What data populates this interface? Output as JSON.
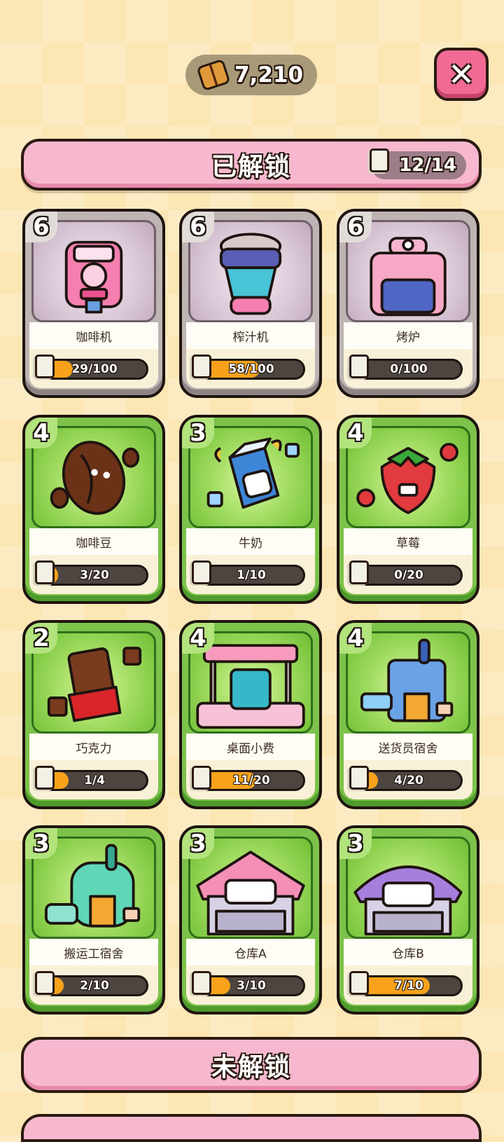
{
  "currency": {
    "amount": "7,210",
    "icon": "coffee-bean-coin-icon"
  },
  "close": {
    "label": "✕"
  },
  "unlocked": {
    "title": "已解锁",
    "count": "12/14"
  },
  "locked": {
    "title": "未解锁"
  },
  "cards": [
    {
      "name": "咖啡机",
      "level": "6",
      "progress": "29/100",
      "fill": 0.29,
      "style": "gray",
      "icon": "coffee-machine-icon"
    },
    {
      "name": "榨汁机",
      "level": "6",
      "progress": "58/100",
      "fill": 0.58,
      "style": "gray",
      "icon": "juicer-icon"
    },
    {
      "name": "烤炉",
      "level": "6",
      "progress": "0/100",
      "fill": 0.0,
      "style": "gray",
      "icon": "oven-icon"
    },
    {
      "name": "咖啡豆",
      "level": "4",
      "progress": "3/20",
      "fill": 0.15,
      "style": "green",
      "icon": "coffee-bean-icon"
    },
    {
      "name": "牛奶",
      "level": "3",
      "progress": "1/10",
      "fill": 0.1,
      "style": "green",
      "icon": "milk-carton-icon"
    },
    {
      "name": "草莓",
      "level": "4",
      "progress": "0/20",
      "fill": 0.0,
      "style": "green",
      "icon": "strawberry-icon"
    },
    {
      "name": "巧克力",
      "level": "2",
      "progress": "1/4",
      "fill": 0.25,
      "style": "green",
      "icon": "chocolate-icon"
    },
    {
      "name": "桌面小费",
      "level": "4",
      "progress": "11/20",
      "fill": 0.55,
      "style": "green",
      "icon": "tip-stand-icon"
    },
    {
      "name": "送货员宿舍",
      "level": "4",
      "progress": "4/20",
      "fill": 0.2,
      "style": "green",
      "icon": "courier-dorm-icon"
    },
    {
      "name": "搬运工宿舍",
      "level": "3",
      "progress": "2/10",
      "fill": 0.2,
      "style": "green",
      "icon": "porter-dorm-icon"
    },
    {
      "name": "仓库A",
      "level": "3",
      "progress": "3/10",
      "fill": 0.3,
      "style": "green",
      "icon": "warehouse-a-icon"
    },
    {
      "name": "仓库B",
      "level": "3",
      "progress": "7/10",
      "fill": 0.7,
      "style": "green",
      "icon": "warehouse-b-icon"
    }
  ]
}
